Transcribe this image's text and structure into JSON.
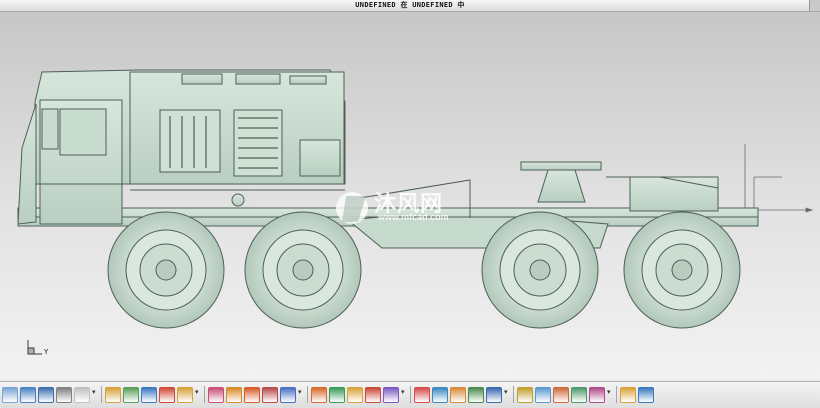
{
  "window": {
    "title": "UNDEFINED 在 UNDEFINED 中"
  },
  "watermark": {
    "brand": "沐风网",
    "url": "www.mfcad.com"
  },
  "triad": {
    "axis_label": "Y",
    "left_axis_label": "Y"
  },
  "toolbar": {
    "buttons": [
      {
        "name": "new-icon",
        "color": "#7aa6d6"
      },
      {
        "name": "open-icon",
        "color": "#4b82c4"
      },
      {
        "name": "save-icon",
        "color": "#3d6fb0"
      },
      {
        "name": "print-icon",
        "color": "#808080"
      },
      {
        "name": "cut-icon",
        "color": "#c0c0c0"
      },
      {
        "name": "copy-icon",
        "color": "#d7a33a"
      },
      {
        "name": "paste-icon",
        "color": "#5aa05a"
      },
      {
        "name": "undo-icon",
        "color": "#3a7ac0"
      },
      {
        "name": "redo-icon",
        "color": "#d04a3a"
      },
      {
        "name": "line-icon",
        "color": "#d9a13b"
      },
      {
        "name": "arc-icon",
        "color": "#c84d7a"
      },
      {
        "name": "circle-icon",
        "color": "#d98a2a"
      },
      {
        "name": "rectangle-icon",
        "color": "#d95c2a"
      },
      {
        "name": "polygon-icon",
        "color": "#b84a4a"
      },
      {
        "name": "extrude-icon",
        "color": "#4a6fc0"
      },
      {
        "name": "revolve-icon",
        "color": "#d86a2a"
      },
      {
        "name": "sweep-icon",
        "color": "#3a9a5a"
      },
      {
        "name": "blend-icon",
        "color": "#d9a33a"
      },
      {
        "name": "hole-icon",
        "color": "#c84a3a"
      },
      {
        "name": "shell-icon",
        "color": "#7a5ac0"
      },
      {
        "name": "pattern-icon",
        "color": "#d94a4a"
      },
      {
        "name": "measure-icon",
        "color": "#3a8ac0"
      },
      {
        "name": "section-icon",
        "color": "#d98a3a"
      },
      {
        "name": "curve-icon",
        "color": "#4a8a4a"
      },
      {
        "name": "spline-icon",
        "color": "#3a6ab0"
      },
      {
        "name": "surface-icon",
        "color": "#c0a030"
      },
      {
        "name": "mirror-icon",
        "color": "#5a9ad0"
      },
      {
        "name": "trim-icon",
        "color": "#d06a3a"
      },
      {
        "name": "offset-icon",
        "color": "#4a9a6a"
      },
      {
        "name": "analysis-icon",
        "color": "#b04a8a"
      },
      {
        "name": "render-icon",
        "color": "#d9a33a"
      },
      {
        "name": "view-icon",
        "color": "#3a7ac0"
      }
    ]
  }
}
